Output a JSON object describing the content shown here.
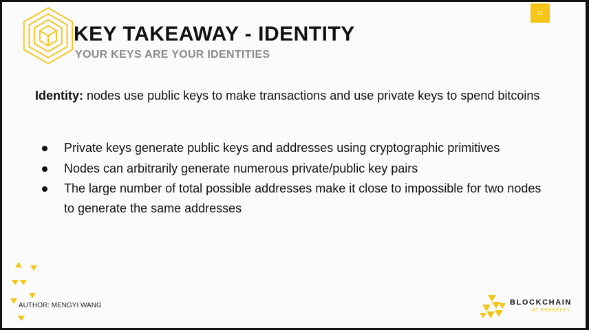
{
  "slide": {
    "title": "KEY TAKEAWAY - IDENTITY",
    "subtitle": "YOUR KEYS ARE YOUR IDENTITIES",
    "page_number": "11",
    "intro": {
      "term": "Identity:",
      "text": " nodes use public keys to make transactions and use private keys to spend  bitcoins"
    },
    "bullets": [
      "Private keys generate public keys and addresses using cryptographic primitives",
      "Nodes can arbitrarily generate numerous private/public key pairs",
      "The large number of total possible addresses make it close to impossible for two nodes to generate the same addresses"
    ],
    "author": "AUTHOR: MENGYI WANG"
  },
  "brand": {
    "name": "BLOCKCHAIN",
    "sub": "AT BERKELEY",
    "accent_color": "#f5c518"
  },
  "icons": {
    "header_logo": "hexagon-cube-logo-icon",
    "footer_logo": "blockchain-at-berkeley-logo-icon",
    "decoration": "yellow-triangles-icon"
  }
}
